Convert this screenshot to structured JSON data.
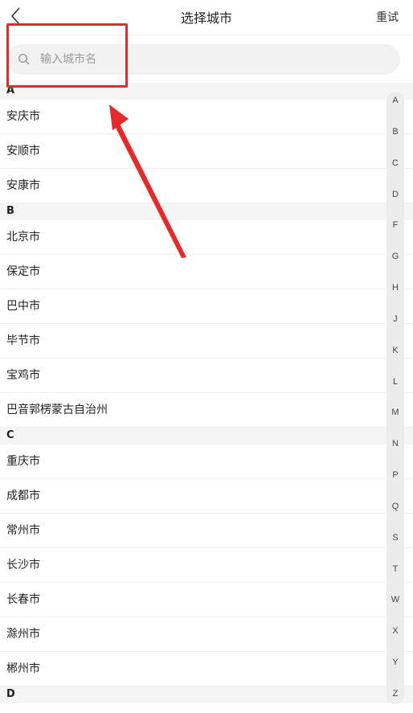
{
  "header": {
    "title": "选择城市",
    "retry_label": "重试",
    "back_icon": "chevron-left-icon"
  },
  "search": {
    "placeholder": "输入城市名",
    "value": "",
    "icon": "search-icon"
  },
  "sections": [
    {
      "letter": "A",
      "cities": [
        "安庆市",
        "安顺市",
        "安康市"
      ]
    },
    {
      "letter": "B",
      "cities": [
        "北京市",
        "保定市",
        "巴中市",
        "毕节市",
        "宝鸡市",
        "巴音郭楞蒙古自治州"
      ]
    },
    {
      "letter": "C",
      "cities": [
        "重庆市",
        "成都市",
        "常州市",
        "长沙市",
        "长春市",
        "滁州市",
        "郴州市"
      ]
    },
    {
      "letter": "D",
      "cities": []
    }
  ],
  "index_letters": [
    "A",
    "B",
    "C",
    "D",
    "F",
    "G",
    "H",
    "J",
    "K",
    "L",
    "M",
    "N",
    "P",
    "Q",
    "S",
    "T",
    "W",
    "X",
    "Y",
    "Z"
  ],
  "colors": {
    "annotation": "#e52a2a",
    "index_bar": "#ececec",
    "section_bg": "#f5f5f5"
  }
}
